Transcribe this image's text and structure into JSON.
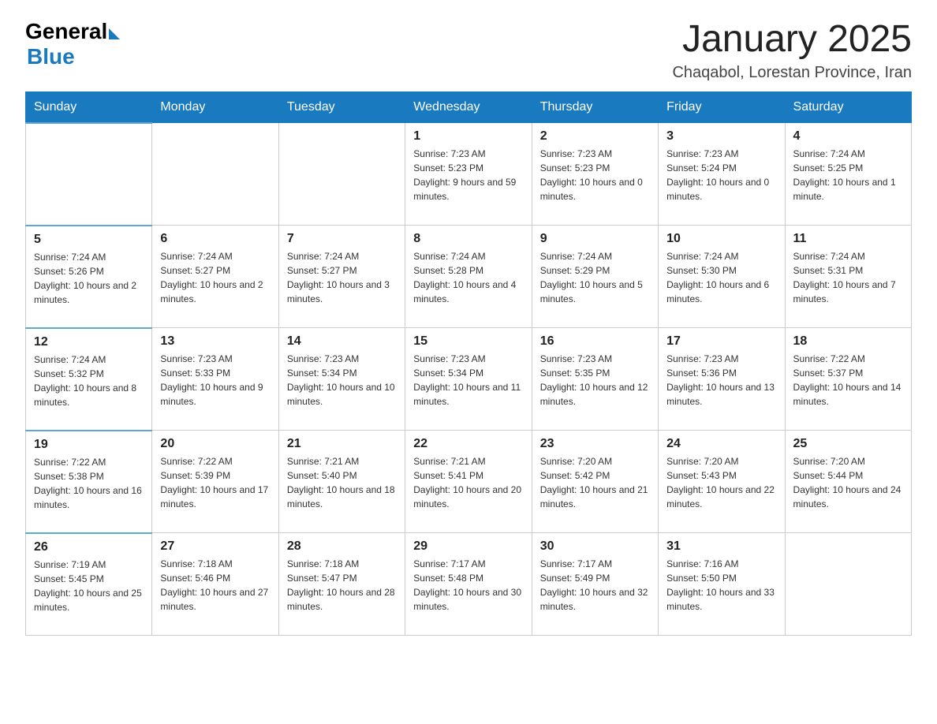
{
  "header": {
    "logo_general": "General",
    "logo_blue": "Blue",
    "month_title": "January 2025",
    "subtitle": "Chaqabol, Lorestan Province, Iran"
  },
  "weekdays": [
    "Sunday",
    "Monday",
    "Tuesday",
    "Wednesday",
    "Thursday",
    "Friday",
    "Saturday"
  ],
  "weeks": [
    [
      {
        "day": "",
        "sunrise": "",
        "sunset": "",
        "daylight": ""
      },
      {
        "day": "",
        "sunrise": "",
        "sunset": "",
        "daylight": ""
      },
      {
        "day": "",
        "sunrise": "",
        "sunset": "",
        "daylight": ""
      },
      {
        "day": "1",
        "sunrise": "Sunrise: 7:23 AM",
        "sunset": "Sunset: 5:23 PM",
        "daylight": "Daylight: 9 hours and 59 minutes."
      },
      {
        "day": "2",
        "sunrise": "Sunrise: 7:23 AM",
        "sunset": "Sunset: 5:23 PM",
        "daylight": "Daylight: 10 hours and 0 minutes."
      },
      {
        "day": "3",
        "sunrise": "Sunrise: 7:23 AM",
        "sunset": "Sunset: 5:24 PM",
        "daylight": "Daylight: 10 hours and 0 minutes."
      },
      {
        "day": "4",
        "sunrise": "Sunrise: 7:24 AM",
        "sunset": "Sunset: 5:25 PM",
        "daylight": "Daylight: 10 hours and 1 minute."
      }
    ],
    [
      {
        "day": "5",
        "sunrise": "Sunrise: 7:24 AM",
        "sunset": "Sunset: 5:26 PM",
        "daylight": "Daylight: 10 hours and 2 minutes."
      },
      {
        "day": "6",
        "sunrise": "Sunrise: 7:24 AM",
        "sunset": "Sunset: 5:27 PM",
        "daylight": "Daylight: 10 hours and 2 minutes."
      },
      {
        "day": "7",
        "sunrise": "Sunrise: 7:24 AM",
        "sunset": "Sunset: 5:27 PM",
        "daylight": "Daylight: 10 hours and 3 minutes."
      },
      {
        "day": "8",
        "sunrise": "Sunrise: 7:24 AM",
        "sunset": "Sunset: 5:28 PM",
        "daylight": "Daylight: 10 hours and 4 minutes."
      },
      {
        "day": "9",
        "sunrise": "Sunrise: 7:24 AM",
        "sunset": "Sunset: 5:29 PM",
        "daylight": "Daylight: 10 hours and 5 minutes."
      },
      {
        "day": "10",
        "sunrise": "Sunrise: 7:24 AM",
        "sunset": "Sunset: 5:30 PM",
        "daylight": "Daylight: 10 hours and 6 minutes."
      },
      {
        "day": "11",
        "sunrise": "Sunrise: 7:24 AM",
        "sunset": "Sunset: 5:31 PM",
        "daylight": "Daylight: 10 hours and 7 minutes."
      }
    ],
    [
      {
        "day": "12",
        "sunrise": "Sunrise: 7:24 AM",
        "sunset": "Sunset: 5:32 PM",
        "daylight": "Daylight: 10 hours and 8 minutes."
      },
      {
        "day": "13",
        "sunrise": "Sunrise: 7:23 AM",
        "sunset": "Sunset: 5:33 PM",
        "daylight": "Daylight: 10 hours and 9 minutes."
      },
      {
        "day": "14",
        "sunrise": "Sunrise: 7:23 AM",
        "sunset": "Sunset: 5:34 PM",
        "daylight": "Daylight: 10 hours and 10 minutes."
      },
      {
        "day": "15",
        "sunrise": "Sunrise: 7:23 AM",
        "sunset": "Sunset: 5:34 PM",
        "daylight": "Daylight: 10 hours and 11 minutes."
      },
      {
        "day": "16",
        "sunrise": "Sunrise: 7:23 AM",
        "sunset": "Sunset: 5:35 PM",
        "daylight": "Daylight: 10 hours and 12 minutes."
      },
      {
        "day": "17",
        "sunrise": "Sunrise: 7:23 AM",
        "sunset": "Sunset: 5:36 PM",
        "daylight": "Daylight: 10 hours and 13 minutes."
      },
      {
        "day": "18",
        "sunrise": "Sunrise: 7:22 AM",
        "sunset": "Sunset: 5:37 PM",
        "daylight": "Daylight: 10 hours and 14 minutes."
      }
    ],
    [
      {
        "day": "19",
        "sunrise": "Sunrise: 7:22 AM",
        "sunset": "Sunset: 5:38 PM",
        "daylight": "Daylight: 10 hours and 16 minutes."
      },
      {
        "day": "20",
        "sunrise": "Sunrise: 7:22 AM",
        "sunset": "Sunset: 5:39 PM",
        "daylight": "Daylight: 10 hours and 17 minutes."
      },
      {
        "day": "21",
        "sunrise": "Sunrise: 7:21 AM",
        "sunset": "Sunset: 5:40 PM",
        "daylight": "Daylight: 10 hours and 18 minutes."
      },
      {
        "day": "22",
        "sunrise": "Sunrise: 7:21 AM",
        "sunset": "Sunset: 5:41 PM",
        "daylight": "Daylight: 10 hours and 20 minutes."
      },
      {
        "day": "23",
        "sunrise": "Sunrise: 7:20 AM",
        "sunset": "Sunset: 5:42 PM",
        "daylight": "Daylight: 10 hours and 21 minutes."
      },
      {
        "day": "24",
        "sunrise": "Sunrise: 7:20 AM",
        "sunset": "Sunset: 5:43 PM",
        "daylight": "Daylight: 10 hours and 22 minutes."
      },
      {
        "day": "25",
        "sunrise": "Sunrise: 7:20 AM",
        "sunset": "Sunset: 5:44 PM",
        "daylight": "Daylight: 10 hours and 24 minutes."
      }
    ],
    [
      {
        "day": "26",
        "sunrise": "Sunrise: 7:19 AM",
        "sunset": "Sunset: 5:45 PM",
        "daylight": "Daylight: 10 hours and 25 minutes."
      },
      {
        "day": "27",
        "sunrise": "Sunrise: 7:18 AM",
        "sunset": "Sunset: 5:46 PM",
        "daylight": "Daylight: 10 hours and 27 minutes."
      },
      {
        "day": "28",
        "sunrise": "Sunrise: 7:18 AM",
        "sunset": "Sunset: 5:47 PM",
        "daylight": "Daylight: 10 hours and 28 minutes."
      },
      {
        "day": "29",
        "sunrise": "Sunrise: 7:17 AM",
        "sunset": "Sunset: 5:48 PM",
        "daylight": "Daylight: 10 hours and 30 minutes."
      },
      {
        "day": "30",
        "sunrise": "Sunrise: 7:17 AM",
        "sunset": "Sunset: 5:49 PM",
        "daylight": "Daylight: 10 hours and 32 minutes."
      },
      {
        "day": "31",
        "sunrise": "Sunrise: 7:16 AM",
        "sunset": "Sunset: 5:50 PM",
        "daylight": "Daylight: 10 hours and 33 minutes."
      },
      {
        "day": "",
        "sunrise": "",
        "sunset": "",
        "daylight": ""
      }
    ]
  ],
  "colors": {
    "header_bg": "#1a7abf",
    "header_text": "#ffffff",
    "border": "#cccccc",
    "row_border_top": "#5fa8d3"
  }
}
